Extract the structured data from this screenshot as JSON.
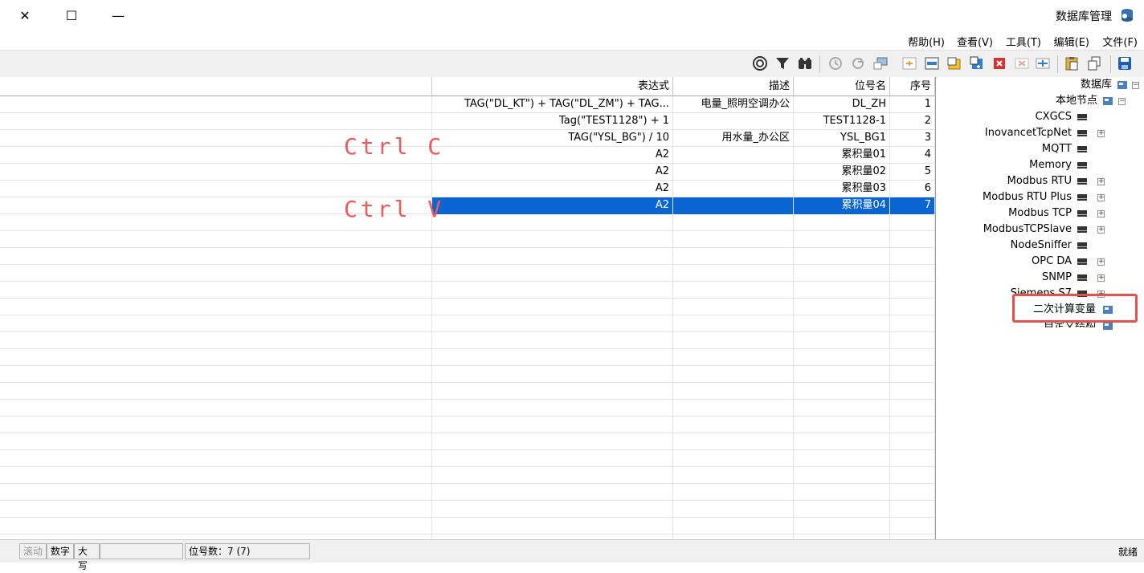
{
  "window": {
    "title": "数据库管理",
    "minimize_glyph": "—",
    "maximize_glyph": "☐",
    "close_glyph": "✕"
  },
  "menu": [
    "文件(F)",
    "编辑(E)",
    "工具(T)",
    "查看(V)",
    "帮助(H)"
  ],
  "toolbar_icons": [
    "save-icon",
    "copy-icon",
    "paste-icon",
    "add-row-icon",
    "delete-icon",
    "export-icon",
    "import-icon",
    "insert-icon",
    "refresh-icon",
    "history-icon",
    "find-icon",
    "filter-icon",
    "help-icon"
  ],
  "table": {
    "headers": {
      "seq": "序号",
      "name": "位号名",
      "desc": "描述",
      "expr": "表达式"
    },
    "rows": [
      {
        "seq": "1",
        "name": "DL_ZH",
        "desc": "电量_照明空调办公",
        "expr": "TAG(\"DL_KT\") + TAG(\"DL_ZM\") + TAG..."
      },
      {
        "seq": "2",
        "name": "TEST1128-1",
        "desc": "",
        "expr": "Tag(\"TEST1128\") + 1"
      },
      {
        "seq": "3",
        "name": "YSL_BG1",
        "desc": "用水量_办公区",
        "expr": "TAG(\"YSL_BG\") / 10"
      },
      {
        "seq": "4",
        "name": "累积量01",
        "desc": "",
        "expr": "A2"
      },
      {
        "seq": "5",
        "name": "累积量02",
        "desc": "",
        "expr": "A2"
      },
      {
        "seq": "6",
        "name": "累积量03",
        "desc": "",
        "expr": "A2"
      },
      {
        "seq": "7",
        "name": "累积量04",
        "desc": "",
        "expr": "A2"
      }
    ],
    "selected_index": 6
  },
  "annotations": {
    "copy": "Ctrl C",
    "paste": "Ctrl V"
  },
  "tree": {
    "root": "数据库",
    "local_node": "本地节点",
    "drivers": [
      "CXGCS",
      "InovancetTcpNet",
      "MQTT",
      "Memory",
      "Modbus RTU",
      "Modbus RTU Plus",
      "Modbus TCP",
      "ModbusTCPSlave",
      "NodeSniffer",
      "OPC DA",
      "SNMP",
      "Siemens S7"
    ],
    "calc_var": "二次计算变量",
    "custom_struct": "自定义结构"
  },
  "status": {
    "ready": "就绪",
    "tag_count": "位号数：7 (7)",
    "caps": "大写",
    "num": "数字",
    "scroll": "滚动"
  },
  "colors": {
    "accent": "#0a64d2",
    "annotation": "#f05a5a",
    "highlight": "#e5504f"
  }
}
